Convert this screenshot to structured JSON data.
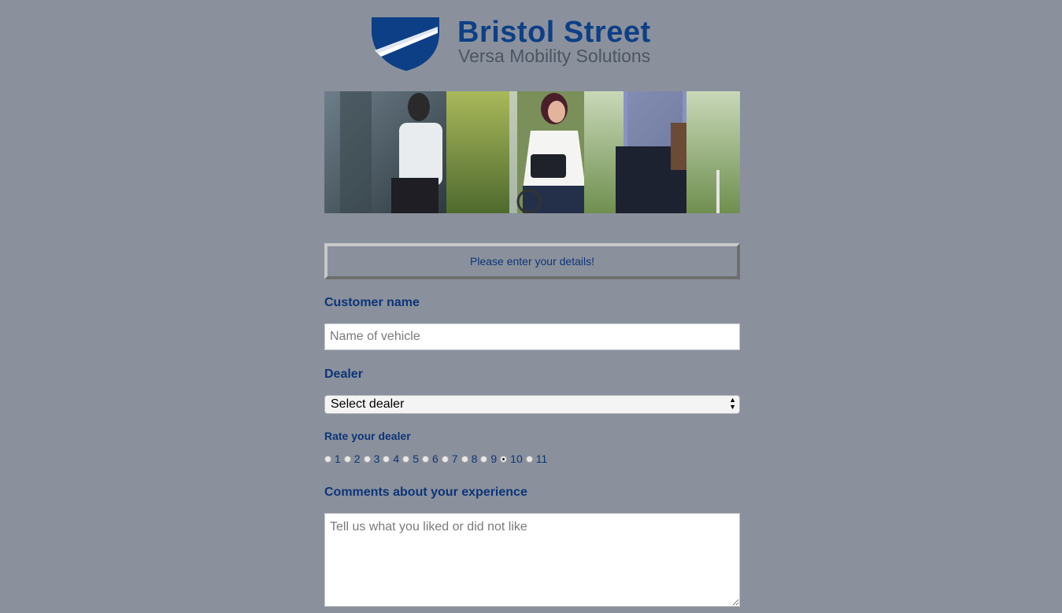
{
  "brand": {
    "name": "Bristol Street",
    "tagline": "Versa Mobility Solutions",
    "primary_color": "#0d3f86",
    "shield_icon": "shield-logo-icon"
  },
  "hero": {
    "description_icon": "hero-photo"
  },
  "notice": {
    "text": "Please enter your details!"
  },
  "form": {
    "customer_name": {
      "label": "Customer name",
      "placeholder": "Name of vehicle",
      "value": ""
    },
    "dealer": {
      "label": "Dealer",
      "selected": "Select dealer"
    },
    "rating": {
      "label": "Rate your dealer",
      "options": [
        "1",
        "2",
        "3",
        "4",
        "5",
        "6",
        "7",
        "8",
        "9",
        "10",
        "11"
      ],
      "selected_index": 9
    },
    "comments": {
      "label": "Comments about your experience",
      "placeholder": "Tell us what you liked or did not like",
      "value": ""
    }
  },
  "colors": {
    "background": "#8a919c",
    "label": "#0d3478"
  }
}
